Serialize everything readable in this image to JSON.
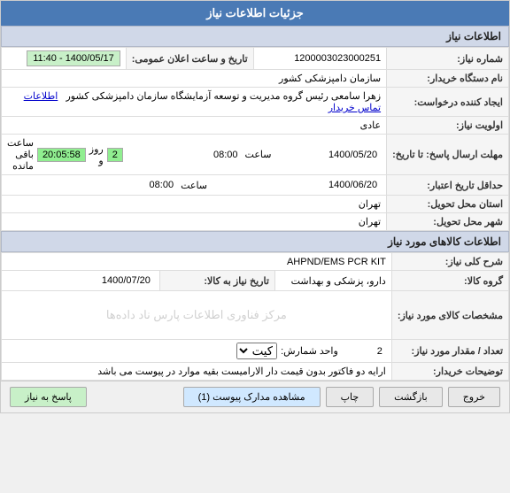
{
  "header": {
    "title": "جزئیات اطلاعات نیاز"
  },
  "info_section": {
    "title": "اطلاعات نیاز",
    "fields": {
      "order_number_label": "شماره نیاز:",
      "order_number_value": "1200003023000251",
      "date_label": "تاریخ و ساعت اعلان عمومی:",
      "date_value": "1400/05/17 - 11:40",
      "buyer_label": "نام دستگاه خریدار:",
      "buyer_value": "سازمان دامپزشکی کشور",
      "request_label": "ایجاد کننده درخواست:",
      "request_value": "زهرا سامعی رئیس گروه مدیریت و توسعه آزمایشگاه سازمان دامپزشکی کشور",
      "request_link": "اطلاعات تماس خریدار",
      "priority_label": "اولویت نیاز:",
      "priority_value": "عادی",
      "send_from_label": "مهلت ارسال پاسخ: تا تاریخ:",
      "send_from_date": "1400/05/20",
      "send_from_time": "08:00",
      "send_time_label": "ساعت",
      "remaining_label": "روز و",
      "remaining_days": "2",
      "remaining_time": "20:05:58",
      "remaining_suffix": "ساعت باقی مانده",
      "price_from_label": "حداقل تاریخ اعتبار:",
      "price_from_date": "1400/06/20",
      "price_from_time": "08:00",
      "province_label": "استان محل تحویل:",
      "province_value": "تهران",
      "city_label": "شهر محل تحویل:",
      "city_value": "تهران"
    }
  },
  "goods_section": {
    "title": "اطلاعات کالاهای مورد نیاز",
    "fields": {
      "item_type_label": "شرح کلی نیاز:",
      "item_type_value": "AHPND/EMS PCR KIT",
      "group_label": "گروه کالا:",
      "group_value": "دارو، پزشکی و بهداشت",
      "expiry_label": "تاریخ نیاز به کالا:",
      "expiry_value": "1400/07/20",
      "specs_label": "مشخصات کالای مورد نیاز:",
      "count_label": "تعداد / مقدار مورد نیاز:",
      "count_value": "2",
      "unit_label": "واحد شمارش:",
      "unit_value": "کیت",
      "desc_label": "توضیحات خریدار:",
      "desc_value": "ارایه دو فاکتور بدون قیمت دار الارامیست بقیه موارد در پیوست می باشد"
    }
  },
  "watermark": "مرکز فناوری اطلاعات پارس ناد داده‌ها",
  "footer": {
    "reply_btn": "پاسخ به نیاز",
    "view_docs_btn": "مشاهده مدارک پیوست (1)",
    "print_btn": "چاپ",
    "back_btn": "بازگشت",
    "exit_btn": "خروج"
  }
}
